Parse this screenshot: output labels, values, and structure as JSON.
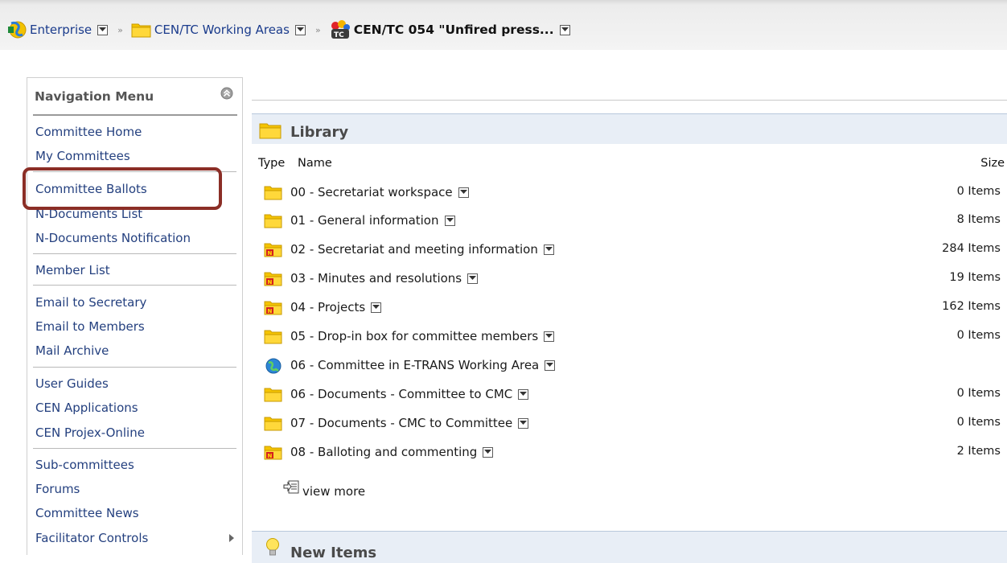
{
  "breadcrumb": {
    "items": [
      {
        "label": "Enterprise",
        "icon": "enterprise-icon"
      },
      {
        "label": "CEN/TC Working Areas",
        "icon": "folder-icon"
      },
      {
        "label": "CEN/TC 054 \"Unfired press...",
        "icon": "tc-committee-icon"
      }
    ],
    "separator": "»"
  },
  "nav": {
    "title": "Navigation Menu",
    "groups": [
      [
        "Committee Home",
        "My Committees"
      ],
      [
        "Committee Ballots",
        "N-Documents List",
        "N-Documents Notification"
      ],
      [
        "Member List"
      ],
      [
        "Email to Secretary",
        "Email to Members",
        "Mail Archive"
      ],
      [
        "User Guides",
        "CEN Applications",
        "CEN Projex-Online"
      ],
      [
        "Sub-committees",
        "Forums",
        "Committee News",
        "Facilitator Controls"
      ]
    ]
  },
  "library": {
    "title": "Library",
    "columns": {
      "type": "Type",
      "name": "Name",
      "size": "Size"
    },
    "rows": [
      {
        "name": "00 - Secretariat workspace",
        "size": "0 Items",
        "icon": "folder-icon"
      },
      {
        "name": "01 - General information",
        "size": "8 Items",
        "icon": "folder-icon"
      },
      {
        "name": "02 - Secretariat and meeting information",
        "size": "284 Items",
        "icon": "notification-folder-icon"
      },
      {
        "name": "03 - Minutes and resolutions",
        "size": "19 Items",
        "icon": "notification-folder-icon"
      },
      {
        "name": "04 - Projects",
        "size": "162 Items",
        "icon": "notification-folder-icon"
      },
      {
        "name": "05 - Drop-in box for committee members",
        "size": "0 Items",
        "icon": "folder-icon"
      },
      {
        "name": "06 - Committee in E-TRANS Working Area",
        "size": "",
        "icon": "globe-link-icon"
      },
      {
        "name": "06 - Documents - Committee to CMC",
        "size": "0 Items",
        "icon": "folder-icon"
      },
      {
        "name": "07 - Documents - CMC to Committee",
        "size": "0 Items",
        "icon": "folder-icon"
      },
      {
        "name": "08 - Balloting and commenting",
        "size": "2 Items",
        "icon": "notification-folder-icon"
      }
    ],
    "view_more": "view more"
  },
  "new_items": {
    "title": "New Items"
  },
  "colors": {
    "link": "#24407f",
    "highlight_box": "#8b2e26",
    "section_header_bg": "#e8eef6",
    "folder_yellow": "#f5c400"
  }
}
